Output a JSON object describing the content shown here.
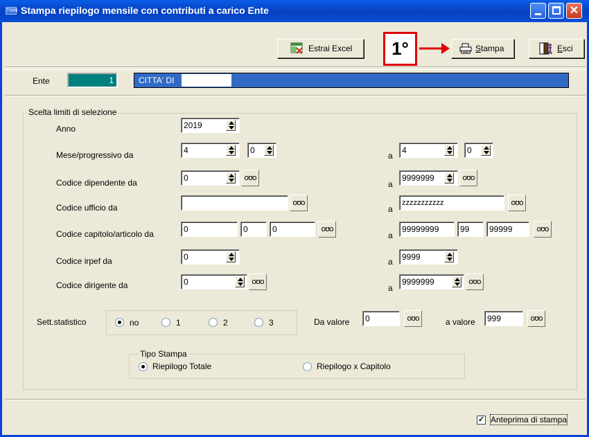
{
  "window": {
    "title": "Stampa riepilogo mensile con contributi a carico Ente",
    "icon_text": "TINN"
  },
  "toolbar": {
    "excel_label": "Estrai Excel",
    "print_label": "Stampa",
    "print_underline": "S",
    "print_rest": "tampa",
    "exit_underline": "E",
    "exit_rest": "sci"
  },
  "annotation": {
    "label": "1°",
    "color": "#e00000"
  },
  "ente": {
    "label": "Ente",
    "code": "1",
    "name": "CITTA' DI"
  },
  "selection": {
    "group_title": "Scelta limiti di selezione",
    "anno": {
      "label": "Anno",
      "value": "2019"
    },
    "mese": {
      "label": "Mese/progressivo da",
      "from_month": "4",
      "from_prog": "0",
      "a": "a",
      "to_month": "4",
      "to_prog": "0"
    },
    "dipendente": {
      "label": "Codice dipendente da",
      "from": "0",
      "a": "a",
      "to": "9999999"
    },
    "ufficio": {
      "label": "Codice ufficio da",
      "from": "",
      "a": "a",
      "to": "zzzzzzzzzzz"
    },
    "capitolo": {
      "label": "Codice capitolo/articolo da",
      "from1": "0",
      "from2": "0",
      "from3": "0",
      "a": "a",
      "to1": "99999999",
      "to2": "99",
      "to3": "99999"
    },
    "irpef": {
      "label": "Codice irpef da",
      "from": "0",
      "a": "a",
      "to": "9999"
    },
    "dirigente": {
      "label": "Codice dirigente da",
      "from": "0",
      "a": "a",
      "to": "9999999"
    },
    "sett": {
      "label": "Sett.statistico",
      "options": [
        "no",
        "1",
        "2",
        "3"
      ],
      "selected": "no",
      "da_label": "Da valore",
      "da_value": "0",
      "a_label": "a valore",
      "a_value": "999"
    },
    "tipo": {
      "title": "Tipo Stampa",
      "options": [
        "Riepilogo Totale",
        "Riepilogo x Capitolo"
      ],
      "selected": "Riepilogo Totale"
    }
  },
  "footer": {
    "preview_label": "Anteprima di stampa",
    "preview_checked": true
  }
}
